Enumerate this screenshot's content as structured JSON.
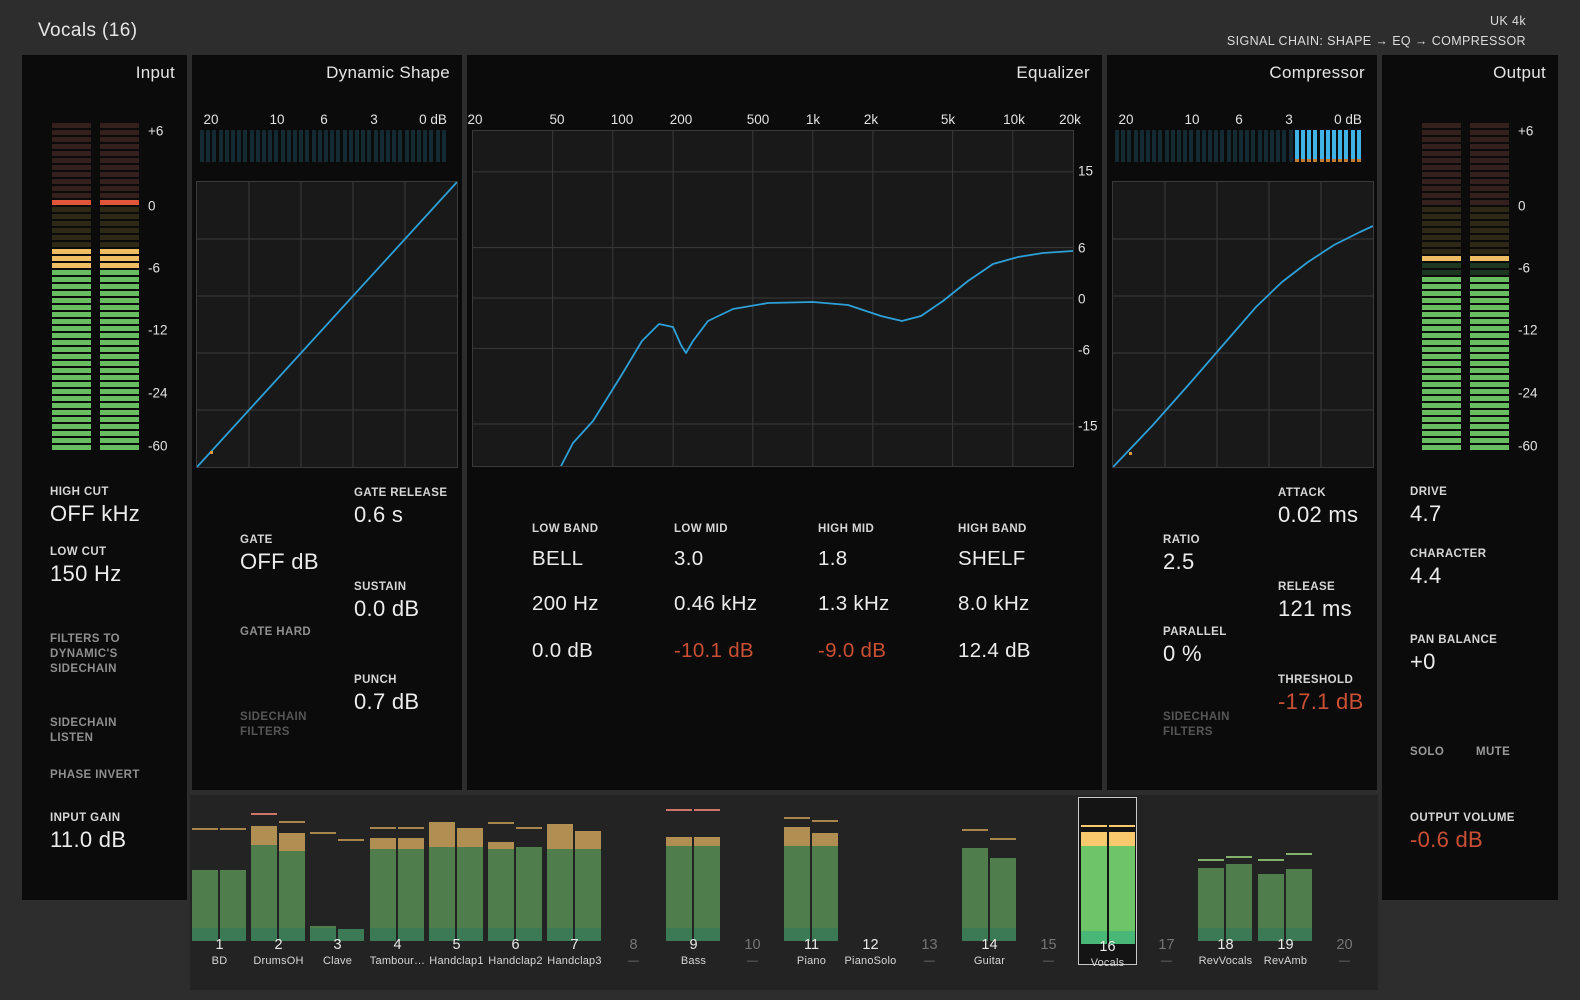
{
  "colors": {
    "accent_blue": "#2da0d8",
    "gr_lit_blue": "#3fb3e6",
    "gr_unlit_teal": "#152b33",
    "meter_green": "#68bd60",
    "meter_yellow": "#f0bd62",
    "meter_peak_red": "#e0563a",
    "alert_red": "#c94f35",
    "track_green": "#4f7d4b",
    "track_green_bright": "#6ec568",
    "track_base_green": "#3c7a55",
    "track_base_bright": "#49b877",
    "cap_tan": "#b18e51",
    "cap_yellow": "#fbc96d",
    "peak_tan": "#a8854d",
    "peak_red": "#cf7468",
    "peak_green": "#83b06b",
    "orange_dot": "#e09a40"
  },
  "header": {
    "title": "Vocals (16)",
    "device": "UK 4k",
    "signal_chain": "SIGNAL CHAIN: SHAPE → EQ → COMPRESSOR"
  },
  "input": {
    "title": "Input",
    "meter_scale": [
      "+6",
      "0",
      "-6",
      "-12",
      "-24",
      "-60"
    ],
    "meter": {
      "segments": 47,
      "dark_red": [
        0,
        10
      ],
      "peak_red": [
        11,
        11
      ],
      "olive": [
        12,
        17
      ],
      "yellow": [
        18,
        20
      ],
      "green": [
        21,
        46
      ]
    },
    "high_cut": {
      "label": "HIGH CUT",
      "value": "OFF kHz"
    },
    "low_cut": {
      "label": "LOW CUT",
      "value": "150 Hz"
    },
    "filters_to_sidechain": "FILTERS TO\nDYNAMIC'S\nSIDECHAIN",
    "sidechain_listen": "SIDECHAIN\nLISTEN",
    "phase_invert": "PHASE INVERT",
    "input_gain": {
      "label": "INPUT GAIN",
      "value": "11.0 dB"
    }
  },
  "shape": {
    "title": "Dynamic Shape",
    "gr_scale": [
      "20",
      "10",
      "6",
      "3",
      "0 dB"
    ],
    "gr_lit_from": null,
    "gate": {
      "label": "GATE",
      "value": "OFF dB"
    },
    "gate_release": {
      "label": "GATE RELEASE",
      "value": "0.6 s"
    },
    "sustain": {
      "label": "SUSTAIN",
      "value": "0.0 dB"
    },
    "punch": {
      "label": "PUNCH",
      "value": "0.7 dB"
    },
    "gate_hard": "GATE HARD",
    "sidechain_filters": "SIDECHAIN\nFILTERS",
    "curve": [
      [
        0,
        285
      ],
      [
        260,
        0
      ]
    ],
    "dot": [
      13,
      269
    ]
  },
  "eq": {
    "title": "Equalizer",
    "freq_scale": [
      "20",
      "50",
      "100",
      "200",
      "500",
      "1k",
      "2k",
      "5k",
      "10k",
      "20k"
    ],
    "db_scale": [
      "15",
      "6",
      "0",
      "-6",
      "-15"
    ],
    "bands": [
      {
        "name": "LOW BAND",
        "shape": "BELL",
        "freq": "200 Hz",
        "gain": "0.0 dB",
        "cut": false
      },
      {
        "name": "LOW MID",
        "shape": "3.0",
        "freq": "0.46 kHz",
        "gain": "-10.1 dB",
        "cut": true
      },
      {
        "name": "HIGH MID",
        "shape": "1.8",
        "freq": "1.3 kHz",
        "gain": "-9.0 dB",
        "cut": true
      },
      {
        "name": "HIGH BAND",
        "shape": "SHELF",
        "freq": "8.0 kHz",
        "gain": "12.4 dB",
        "cut": false
      }
    ],
    "curve": [
      [
        88,
        335
      ],
      [
        100,
        312
      ],
      [
        120,
        290
      ],
      [
        148,
        245
      ],
      [
        169,
        210
      ],
      [
        186,
        193
      ],
      [
        200,
        196
      ],
      [
        208,
        214
      ],
      [
        213,
        222
      ],
      [
        220,
        210
      ],
      [
        235,
        190
      ],
      [
        260,
        178
      ],
      [
        295,
        172
      ],
      [
        340,
        171
      ],
      [
        375,
        174
      ],
      [
        408,
        185
      ],
      [
        429,
        190
      ],
      [
        448,
        185
      ],
      [
        470,
        170
      ],
      [
        495,
        150
      ],
      [
        520,
        133
      ],
      [
        545,
        126
      ],
      [
        570,
        122
      ],
      [
        600,
        120
      ]
    ]
  },
  "compressor": {
    "title": "Compressor",
    "gr_scale": [
      "20",
      "10",
      "6",
      "3",
      "0 dB"
    ],
    "gr_lit_from": 29,
    "ratio": {
      "label": "RATIO",
      "value": "2.5"
    },
    "attack": {
      "label": "ATTACK",
      "value": "0.02 ms"
    },
    "release": {
      "label": "RELEASE",
      "value": "121 ms"
    },
    "parallel": {
      "label": "PARALLEL",
      "value": "0 %"
    },
    "threshold": {
      "label": "THRESHOLD",
      "value": "-17.1 dB"
    },
    "sidechain_filters": "SIDECHAIN\nFILTERS",
    "curve": [
      [
        0,
        285
      ],
      [
        39,
        244
      ],
      [
        78,
        200
      ],
      [
        117,
        155
      ],
      [
        143,
        125
      ],
      [
        169,
        100
      ],
      [
        195,
        80
      ],
      [
        221,
        63
      ],
      [
        247,
        50
      ],
      [
        260,
        44
      ]
    ],
    "dot": [
      16,
      270
    ]
  },
  "output": {
    "title": "Output",
    "meter_scale": [
      "+6",
      "0",
      "-6",
      "-12",
      "-24",
      "-60"
    ],
    "meter": {
      "segments": 47,
      "dark_red": [
        0,
        11
      ],
      "olive": [
        12,
        18
      ],
      "yellow": [
        19,
        19
      ],
      "dark_green": [
        20,
        21
      ],
      "green": [
        22,
        46
      ]
    },
    "drive": {
      "label": "DRIVE",
      "value": "4.7"
    },
    "character": {
      "label": "CHARACTER",
      "value": "4.4"
    },
    "pan_balance": {
      "label": "PAN BALANCE",
      "value": "+0"
    },
    "solo": "SOLO",
    "mute": "MUTE",
    "output_volume": {
      "label": "OUTPUT VOLUME",
      "value": "-0.6 dB"
    }
  },
  "tracks": [
    {
      "n": "1",
      "name": "BD",
      "active": true,
      "selected": false,
      "bright": false,
      "bars": [
        {
          "green": 71,
          "peak": 111,
          "peakColor": "tan"
        },
        {
          "green": 71,
          "peak": 111,
          "peakColor": "tan"
        }
      ]
    },
    {
      "n": "2",
      "name": "DrumsOH",
      "active": true,
      "selected": false,
      "bright": false,
      "bars": [
        {
          "green": 96,
          "cap": [
            96,
            115
          ],
          "capColor": "tan",
          "peak": 126,
          "peakColor": "red"
        },
        {
          "green": 90,
          "cap": [
            90,
            108
          ],
          "capColor": "tan",
          "peak": 118,
          "peakColor": "tan"
        }
      ]
    },
    {
      "n": "3",
      "name": "Clave",
      "active": true,
      "selected": false,
      "bright": false,
      "bars": [
        {
          "green": 15,
          "peak": 107,
          "peakColor": "tan"
        },
        {
          "green": 12,
          "peak": 100,
          "peakColor": "tan"
        }
      ]
    },
    {
      "n": "4",
      "name": "Tambour…",
      "active": true,
      "selected": false,
      "bright": false,
      "bars": [
        {
          "green": 92,
          "cap": [
            92,
            103
          ],
          "capColor": "tan",
          "peak": 112,
          "peakColor": "tan"
        },
        {
          "green": 92,
          "cap": [
            92,
            103
          ],
          "capColor": "tan",
          "peak": 112,
          "peakColor": "tan"
        }
      ]
    },
    {
      "n": "5",
      "name": "Handclap1",
      "active": true,
      "selected": false,
      "bright": false,
      "bars": [
        {
          "green": 94,
          "cap": [
            94,
            119
          ],
          "capColor": "tan"
        },
        {
          "green": 94,
          "cap": [
            94,
            113
          ],
          "capColor": "tan"
        }
      ]
    },
    {
      "n": "6",
      "name": "Handclap2",
      "active": true,
      "selected": false,
      "bright": false,
      "bars": [
        {
          "green": 92,
          "cap": [
            92,
            99
          ],
          "capColor": "tan",
          "peak": 117,
          "peakColor": "tan"
        },
        {
          "green": 94,
          "peak": 112,
          "peakColor": "tan"
        }
      ]
    },
    {
      "n": "7",
      "name": "Handclap3",
      "active": true,
      "selected": false,
      "bright": false,
      "bars": [
        {
          "green": 92,
          "cap": [
            92,
            117
          ],
          "capColor": "tan"
        },
        {
          "green": 92,
          "cap": [
            92,
            110
          ],
          "capColor": "tan"
        }
      ]
    },
    {
      "n": "8",
      "name": "—",
      "active": false,
      "selected": false,
      "bright": false,
      "bars": []
    },
    {
      "n": "9",
      "name": "Bass",
      "active": true,
      "selected": false,
      "bright": false,
      "bars": [
        {
          "green": 95,
          "cap": [
            95,
            104
          ],
          "capColor": "tan",
          "peak": 130,
          "peakColor": "red"
        },
        {
          "green": 95,
          "cap": [
            95,
            104
          ],
          "capColor": "tan",
          "peak": 130,
          "peakColor": "red"
        }
      ]
    },
    {
      "n": "10",
      "name": "—",
      "active": false,
      "selected": false,
      "bright": false,
      "bars": []
    },
    {
      "n": "11",
      "name": "Piano",
      "active": true,
      "selected": false,
      "bright": false,
      "bars": [
        {
          "green": 95,
          "cap": [
            95,
            114
          ],
          "capColor": "tan",
          "peak": 122,
          "peakColor": "tan"
        },
        {
          "green": 95,
          "cap": [
            95,
            108
          ],
          "capColor": "tan",
          "peak": 119,
          "peakColor": "tan"
        }
      ]
    },
    {
      "n": "12",
      "name": "PianoSolo",
      "active": true,
      "selected": false,
      "bright": false,
      "bars": []
    },
    {
      "n": "13",
      "name": "—",
      "active": false,
      "selected": false,
      "bright": false,
      "bars": []
    },
    {
      "n": "14",
      "name": "Guitar",
      "active": true,
      "selected": false,
      "bright": false,
      "bars": [
        {
          "green": 93,
          "peak": 110,
          "peakColor": "tan"
        },
        {
          "green": 83,
          "peak": 101,
          "peakColor": "tan"
        }
      ]
    },
    {
      "n": "15",
      "name": "—",
      "active": false,
      "selected": false,
      "bright": false,
      "bars": []
    },
    {
      "n": "16",
      "name": "Vocals",
      "active": true,
      "selected": true,
      "bright": true,
      "bars": [
        {
          "green": 98,
          "cap": [
            98,
            112
          ],
          "capColor": "yellow",
          "peak": 117,
          "peakColor": "yellow"
        },
        {
          "green": 98,
          "cap": [
            98,
            112
          ],
          "capColor": "yellow",
          "peak": 117,
          "peakColor": "yellow"
        }
      ]
    },
    {
      "n": "17",
      "name": "—",
      "active": false,
      "selected": false,
      "bright": false,
      "bars": []
    },
    {
      "n": "18",
      "name": "RevVocals",
      "active": true,
      "selected": false,
      "bright": false,
      "bars": [
        {
          "green": 73,
          "peak": 80,
          "peakColor": "green"
        },
        {
          "green": 77,
          "peak": 83,
          "peakColor": "green"
        }
      ]
    },
    {
      "n": "19",
      "name": "RevAmb",
      "active": true,
      "selected": false,
      "bright": false,
      "bars": [
        {
          "green": 67,
          "peak": 80,
          "peakColor": "green"
        },
        {
          "green": 72,
          "peak": 86,
          "peakColor": "green"
        }
      ]
    },
    {
      "n": "20",
      "name": "—",
      "active": false,
      "selected": false,
      "bright": false,
      "bars": []
    }
  ]
}
